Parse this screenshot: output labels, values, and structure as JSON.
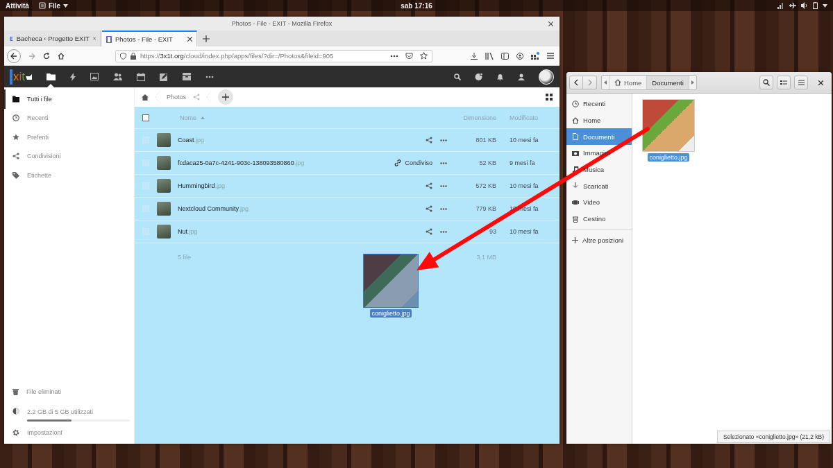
{
  "top_bar": {
    "activities": "Attività",
    "app_menu": "File",
    "clock": "sab 17:16"
  },
  "browser": {
    "title": "Photos - File - EXIT - Mozilla Firefox",
    "tabs": [
      {
        "label": "Bacheca ‹ Progetto EXIT",
        "selected": false
      },
      {
        "label": "Photos - File - EXIT",
        "selected": true
      }
    ],
    "url": {
      "scheme": "https://",
      "domain": "3x1t.org",
      "path": "/cloud/index.php/apps/files/?dir=/Photos&fileid=905"
    }
  },
  "cloud": {
    "logo": "xit",
    "sidebar": {
      "items": [
        {
          "kind": "folder",
          "label": "Tutti i file",
          "selected": true
        },
        {
          "kind": "recent",
          "label": "Recenti",
          "selected": false
        },
        {
          "kind": "star",
          "label": "Preferiti",
          "selected": false
        },
        {
          "kind": "share",
          "label": "Condivisioni",
          "selected": false
        },
        {
          "kind": "tag",
          "label": "Etichette",
          "selected": false
        }
      ],
      "deleted": "File eliminati",
      "quota": {
        "text": "2.2 GB di 5 GB utilizzati",
        "level": 0.43
      },
      "settings": "Impostazioni"
    },
    "breadcrumb": "Photos",
    "table": {
      "select_all": {
        "checked": false
      },
      "columns": {
        "name": "Nome",
        "size": "Dimensione",
        "modified": "Modificato"
      },
      "rows": [
        {
          "kind": "plain",
          "checked": false,
          "name": "Coast",
          "ext": ".jpg",
          "size": "801 KB",
          "modified": "10 mesi fa"
        },
        {
          "kind": "shared",
          "checked": false,
          "name": "fcdaca25-0a7c-4241-903c-138093580860",
          "ext": ".jpg",
          "shared_label": "Condiviso",
          "size": "52 KB",
          "modified": "9 mesi fa"
        },
        {
          "kind": "plain",
          "checked": false,
          "name": "Hummingbird",
          "ext": ".jpg",
          "size": "572 KB",
          "modified": "10 mesi fa"
        },
        {
          "kind": "plain",
          "checked": false,
          "name": "Nextcloud Community",
          "ext": ".jpg",
          "size": "779 KB",
          "modified": "10 mesi fa"
        },
        {
          "kind": "plain",
          "checked": false,
          "name": "Nut",
          "ext": ".jpg",
          "size": "93",
          "modified": "10 mesi fa"
        }
      ],
      "summary": {
        "count": "5 file",
        "size": "3,1 MB"
      }
    }
  },
  "drag_item": {
    "label": "coniglietto.jpg"
  },
  "files_window": {
    "path": [
      {
        "kind": "home",
        "label": "Home",
        "selected": false
      },
      {
        "kind": "folder",
        "label": "Documenti",
        "selected": true
      }
    ],
    "places": [
      {
        "kind": "recent",
        "label": "Recenti",
        "selected": false
      },
      {
        "kind": "home",
        "label": "Home",
        "selected": false
      },
      {
        "kind": "document",
        "label": "Documenti",
        "selected": true
      },
      {
        "kind": "camera",
        "label": "Immagini",
        "selected": false
      },
      {
        "kind": "music",
        "label": "Musica",
        "selected": false
      },
      {
        "kind": "download",
        "label": "Scaricati",
        "selected": false
      },
      {
        "kind": "video",
        "label": "Video",
        "selected": false
      },
      {
        "kind": "trash",
        "label": "Cestino",
        "selected": false
      }
    ],
    "other_places": "Altre posizioni",
    "files": [
      {
        "name": "coniglietto.jpg",
        "selected": true
      }
    ],
    "status": "Selezionato «coniglietto.jpg» (21,2 kB)"
  }
}
